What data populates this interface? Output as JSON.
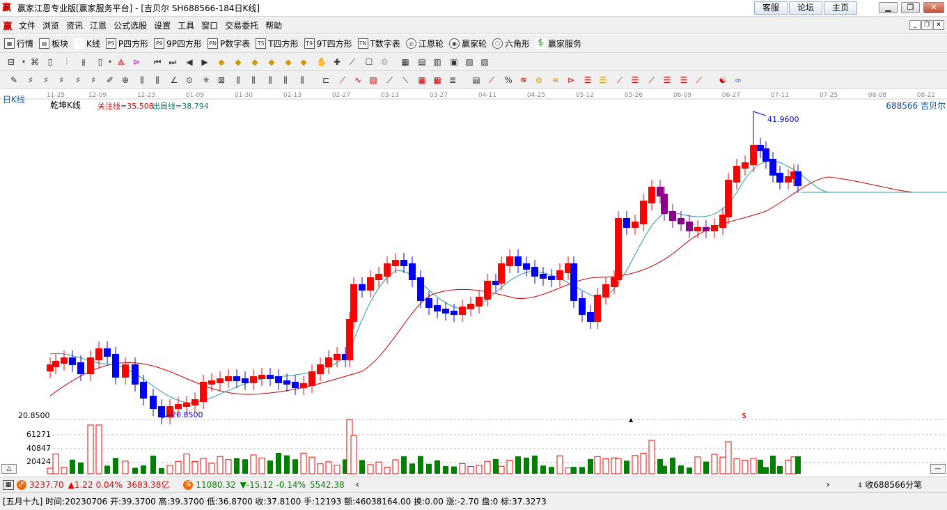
{
  "window": {
    "title": "赢家江恩专业版[赢家服务平台] - [吉贝尔  SH688566-184日K线]",
    "buttons": [
      "客服",
      "论坛",
      "主页"
    ]
  },
  "menu": [
    "文件",
    "浏览",
    "资讯",
    "江恩",
    "公式选股",
    "设置",
    "工具",
    "窗口",
    "交易委托",
    "帮助"
  ],
  "toolbar1": [
    {
      "icon": "quote-table-icon",
      "label": "行情"
    },
    {
      "icon": "sector-icon",
      "label": "板块"
    },
    {
      "icon": "kline-icon",
      "label": "K线"
    },
    {
      "icon": "p-square-icon",
      "label": "P四方形"
    },
    {
      "icon": "9p-square-icon",
      "label": "9P四方形"
    },
    {
      "icon": "p-number-table-icon",
      "label": "P数字表"
    },
    {
      "icon": "t-square-icon",
      "label": "T四方形"
    },
    {
      "icon": "9t-square-icon",
      "label": "9T四方形"
    },
    {
      "icon": "t-number-table-icon",
      "label": "T数字表"
    },
    {
      "icon": "gann-wheel-icon",
      "label": "江恩轮"
    },
    {
      "icon": "winner-wheel-icon",
      "label": "赢家轮"
    },
    {
      "icon": "hexagon-icon",
      "label": "六角形"
    },
    {
      "icon": "dollar-icon",
      "label": "赢家服务"
    }
  ],
  "chart": {
    "period_label": "日K线",
    "indicator_name": "乾坤K线",
    "focus_line": "关注线=35.508",
    "exit_line": "出局线=38.794",
    "stock_label": "688566  吉贝尔",
    "high_label": "41.9600",
    "low_label": "20.8500",
    "price_axis_label": "20.8500",
    "vol_labels": [
      "61271",
      "40847",
      "20424"
    ],
    "dollar_mark": "$",
    "dates": [
      "11-25",
      "12-09",
      "12-23",
      "01-09",
      "01-30",
      "02-13",
      "02-27",
      "03-13",
      "03-27",
      "04-11",
      "04-25",
      "05-12",
      "05-26",
      "06-09",
      "06-27",
      "07-11",
      "07-25",
      "08-08",
      "08-22"
    ]
  },
  "status1": {
    "sh_index": "3237.70",
    "sh_change": "▲1.22",
    "sh_pct": "0.04%",
    "sh_amount": "3683.38亿",
    "sz_index": "11080.32",
    "sz_change": "▼-15.12",
    "sz_pct": "-0.14%",
    "sz_amount": "5542.38",
    "right_text": "收688566分笔"
  },
  "status2": "[五月十九] 时间:20230706 开:39.3700 高:39.3700 低:36.8700 收:37.8100 手:12193 额:46038164.00 换:0.00 涨:-2.70 盘:0 标:37.3273",
  "colors": {
    "up": "#ff0000",
    "down": "#0000ff",
    "purple": "#8b008b",
    "volume_up": "#ff0000",
    "volume_down": "#008000"
  }
}
